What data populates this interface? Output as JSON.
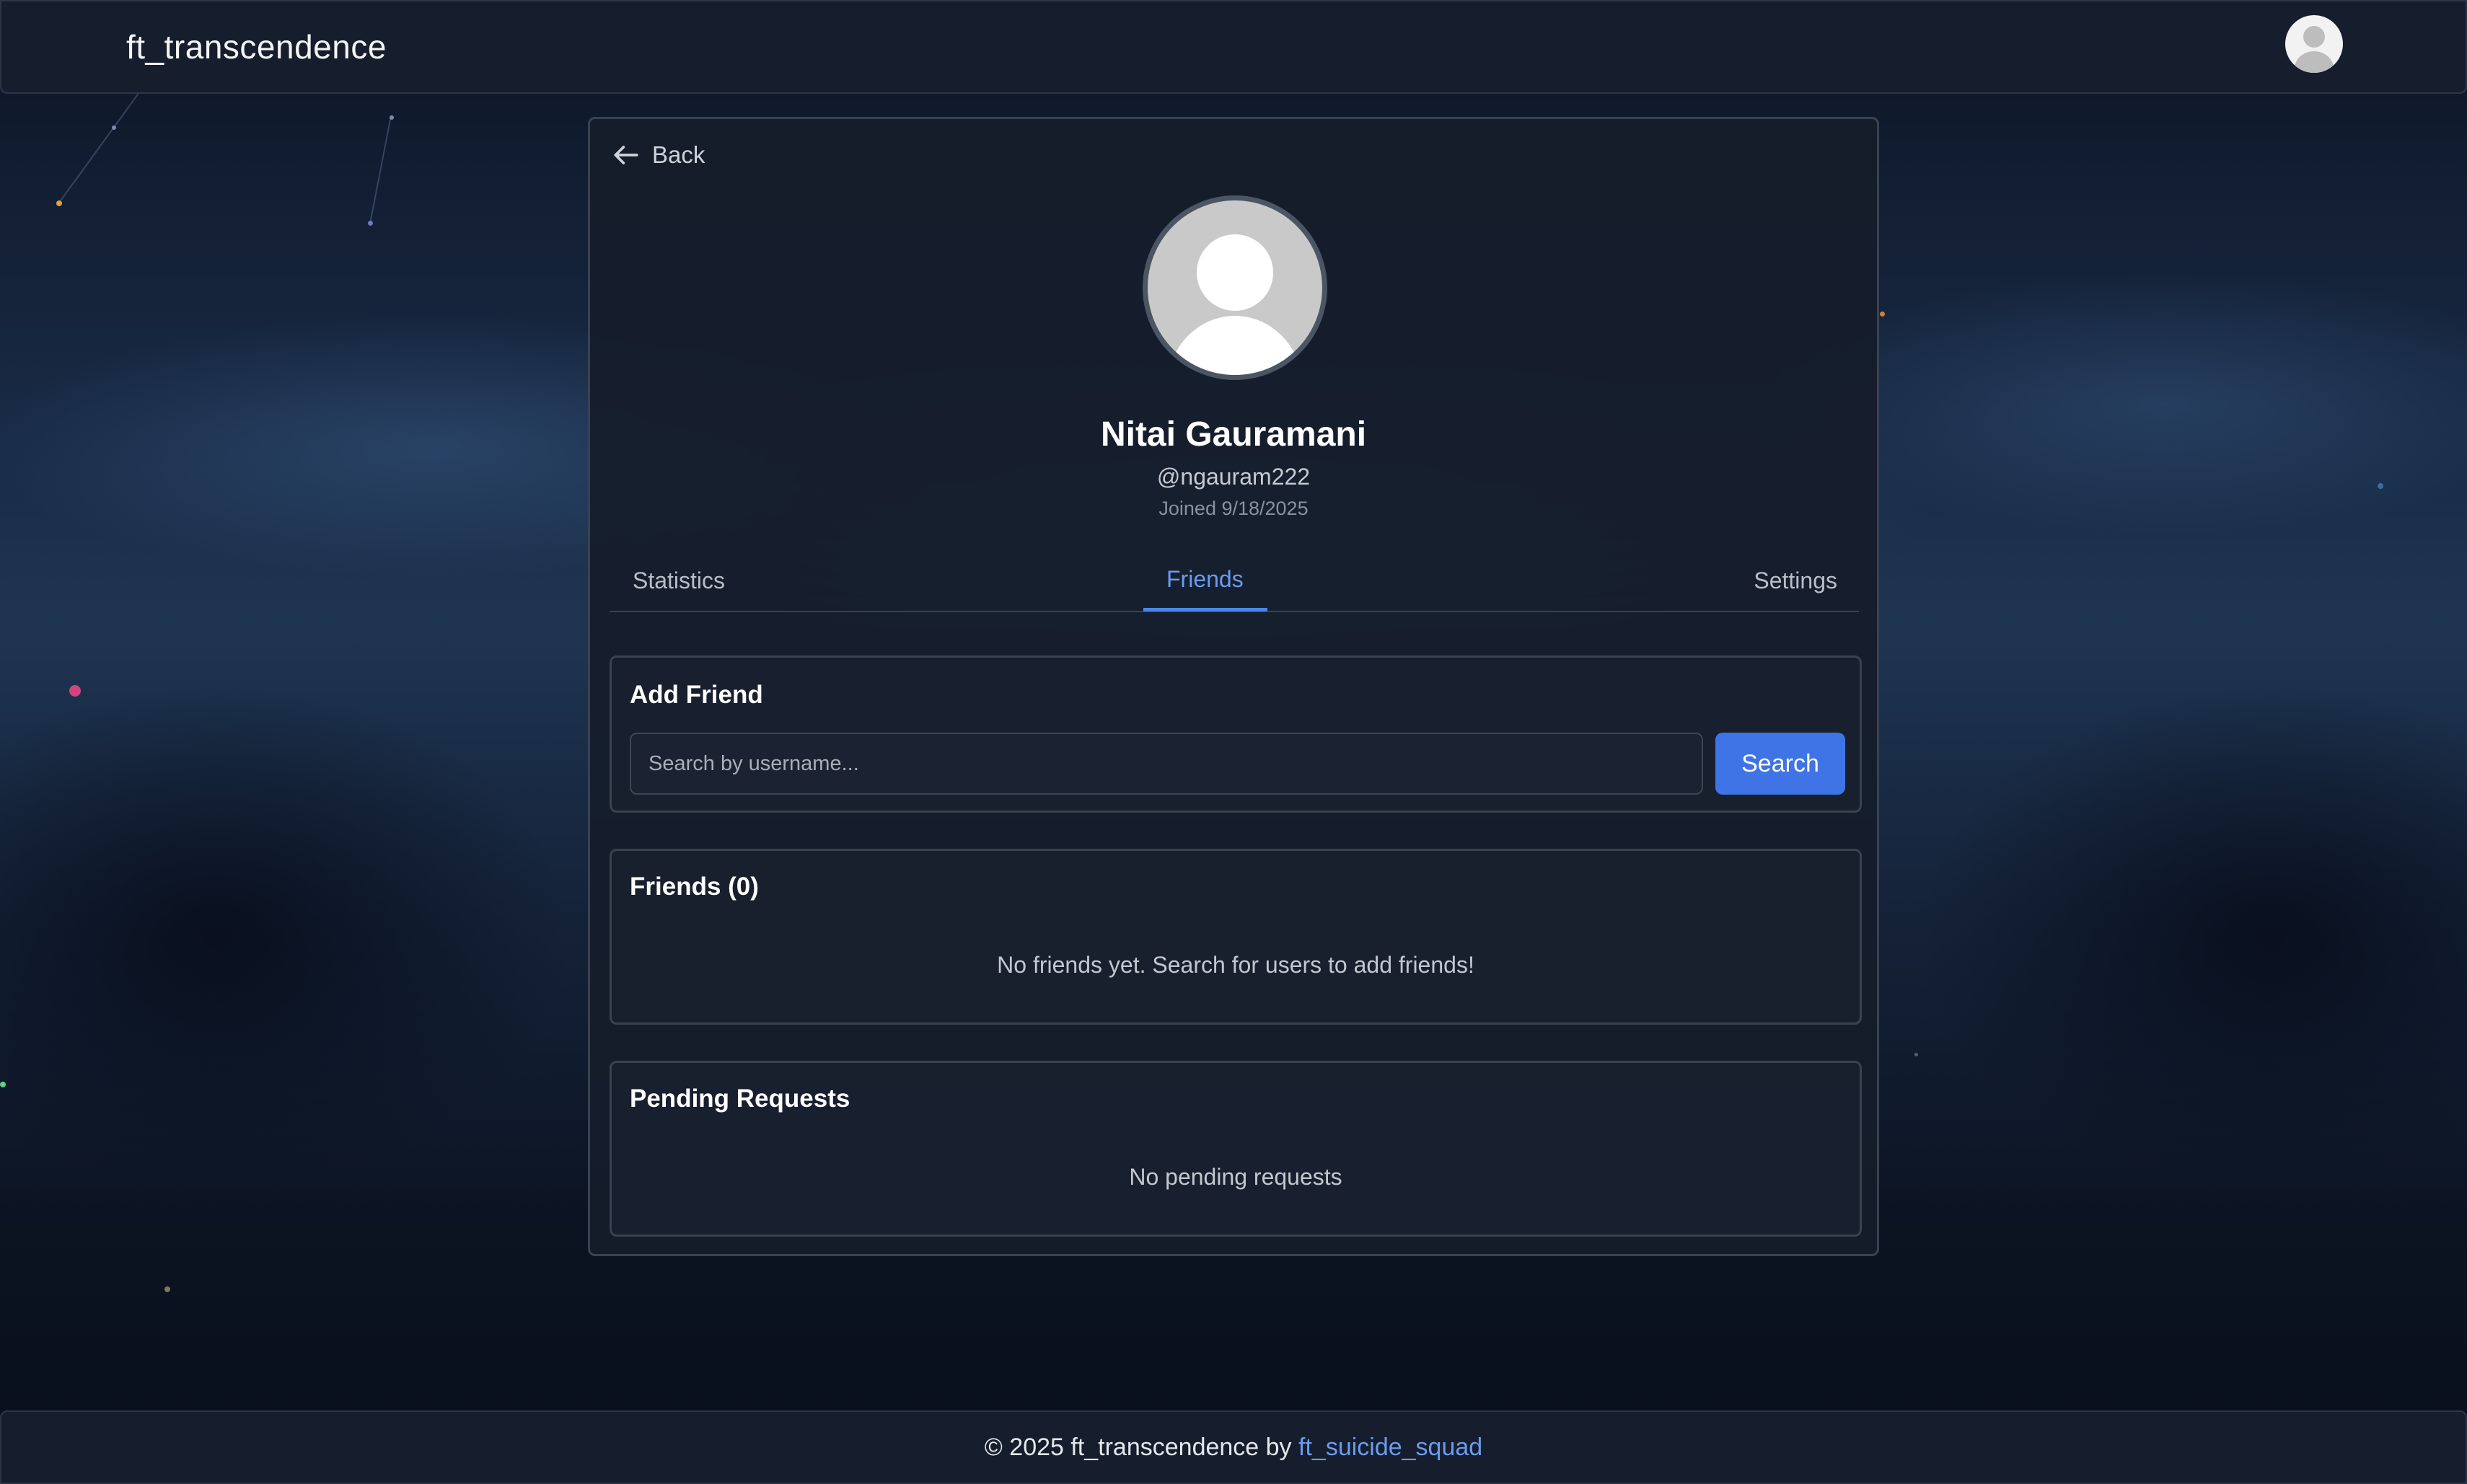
{
  "header": {
    "brand": "ft_transcendence",
    "avatar_icon": "user-avatar-icon"
  },
  "profile": {
    "back_label": "Back",
    "display_name": "Nitai Gauramani",
    "username": "@ngauram222",
    "joined": "Joined 9/18/2025"
  },
  "tabs": [
    {
      "label": "Statistics",
      "active": false
    },
    {
      "label": "Friends",
      "active": true
    },
    {
      "label": "Settings",
      "active": false
    }
  ],
  "add_friend": {
    "title": "Add Friend",
    "search_placeholder": "Search by username...",
    "search_value": "",
    "search_button": "Search"
  },
  "friends": {
    "title": "Friends (0)",
    "empty_message": "No friends yet. Search for users to add friends!"
  },
  "pending": {
    "title": "Pending Requests",
    "empty_message": "No pending requests"
  },
  "footer": {
    "text": "© 2025 ft_transcendence by ",
    "link": "ft_suicide_squad"
  },
  "colors": {
    "accent": "#4d86ea",
    "button": "#3f74e6",
    "card_bg": "#161d2b",
    "link": "#6b9bef"
  }
}
